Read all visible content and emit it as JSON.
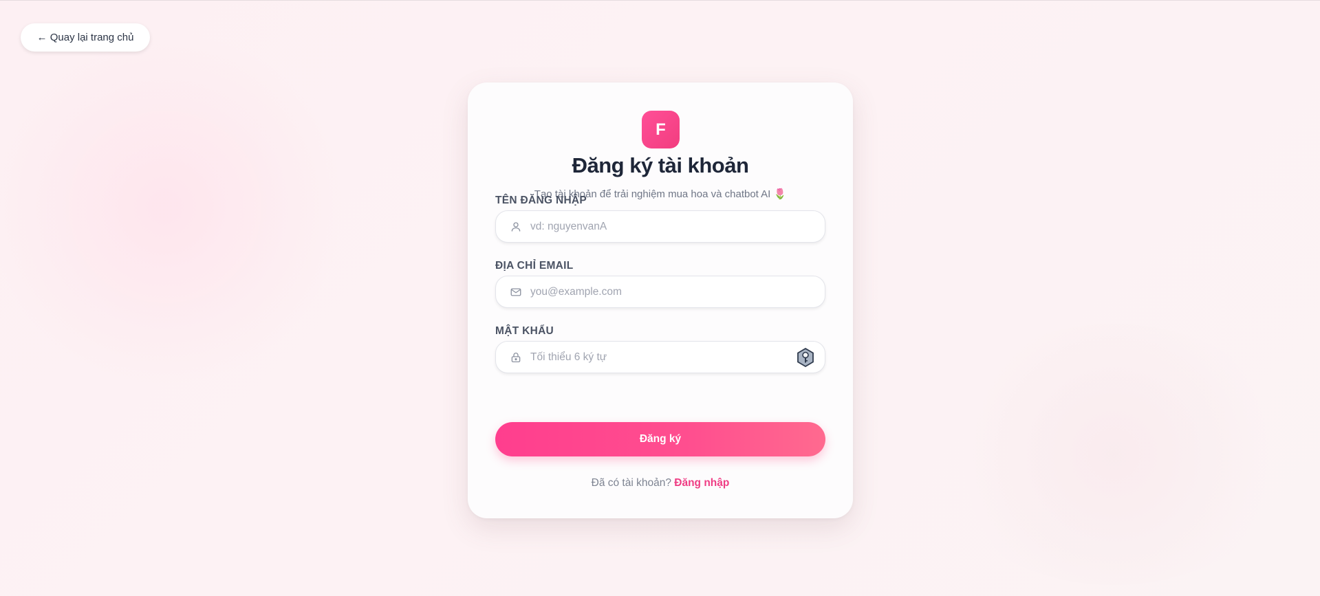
{
  "nav": {
    "back_label": "← Quay lại trang chủ"
  },
  "brand": {
    "logo_letter": "F",
    "accent_color": "#f23d7f"
  },
  "form": {
    "title": "Đăng ký tài khoản",
    "subtitle": "Tạo tài khoản để trải nghiệm mua hoa và chatbot AI 🌷",
    "username": {
      "label": "TÊN ĐĂNG NHẬP",
      "placeholder": "vd: nguyenvanA",
      "value": "",
      "icon": "user-icon"
    },
    "email": {
      "label": "ĐỊA CHỈ EMAIL",
      "placeholder": "you@example.com",
      "value": "",
      "icon": "mail-icon"
    },
    "password": {
      "label": "MẬT KHẨU",
      "placeholder": "Tối thiểu 6 ký tự",
      "value": "",
      "icon": "lock-icon",
      "trailing_icon": "password-manager-key-icon"
    },
    "submit_label": "Đăng ký",
    "footer": {
      "prompt": "Đã có tài khoản?",
      "link_label": "Đăng nhập"
    }
  }
}
